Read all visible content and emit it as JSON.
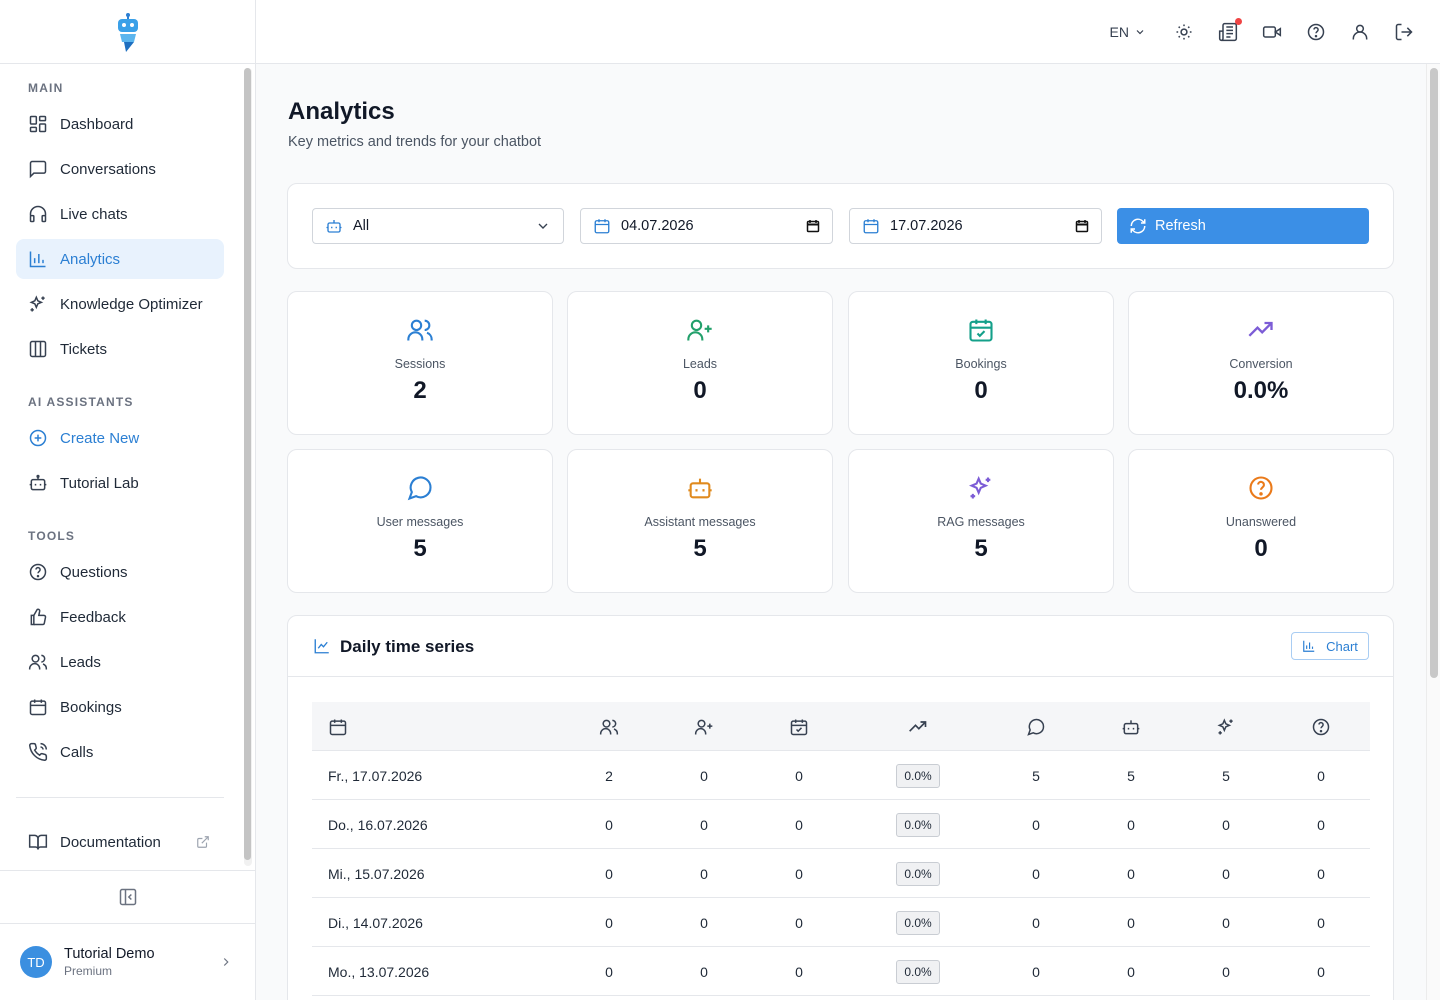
{
  "sidebar": {
    "sections": {
      "main": "MAIN",
      "ai": "AI ASSISTANTS",
      "tools": "TOOLS"
    },
    "main_items": [
      {
        "label": "Dashboard",
        "icon": "dashboard-icon"
      },
      {
        "label": "Conversations",
        "icon": "chat-icon"
      },
      {
        "label": "Live chats",
        "icon": "headset-icon"
      },
      {
        "label": "Analytics",
        "icon": "bar-chart-icon"
      },
      {
        "label": "Knowledge Optimizer",
        "icon": "sparkles-icon"
      },
      {
        "label": "Tickets",
        "icon": "columns-icon"
      }
    ],
    "ai_items": [
      {
        "label": "Create New",
        "icon": "plus-circle-icon"
      },
      {
        "label": "Tutorial Lab",
        "icon": "bot-icon"
      }
    ],
    "tools_items": [
      {
        "label": "Questions",
        "icon": "help-circle-icon"
      },
      {
        "label": "Feedback",
        "icon": "thumbs-up-icon"
      },
      {
        "label": "Leads",
        "icon": "users-icon"
      },
      {
        "label": "Bookings",
        "icon": "calendar-icon"
      },
      {
        "label": "Calls",
        "icon": "phone-icon"
      }
    ],
    "documentation": "Documentation",
    "user": {
      "initials": "TD",
      "name": "Tutorial Demo",
      "plan": "Premium"
    }
  },
  "topbar": {
    "language": "EN"
  },
  "page": {
    "title": "Analytics",
    "subtitle": "Key metrics and trends for your chatbot"
  },
  "filters": {
    "bot_select": "All",
    "date_from": "04.07.2026",
    "date_to": "17.07.2026",
    "refresh": "Refresh"
  },
  "stats": [
    {
      "label": "Sessions",
      "value": "2",
      "color": "#2b7fd3"
    },
    {
      "label": "Leads",
      "value": "0",
      "color": "#22a06b"
    },
    {
      "label": "Bookings",
      "value": "0",
      "color": "#14a08a"
    },
    {
      "label": "Conversion",
      "value": "0.0%",
      "color": "#7c5cd6"
    },
    {
      "label": "User messages",
      "value": "5",
      "color": "#2b7fd3"
    },
    {
      "label": "Assistant messages",
      "value": "5",
      "color": "#e08a1e"
    },
    {
      "label": "RAG messages",
      "value": "5",
      "color": "#7c5cd6"
    },
    {
      "label": "Unanswered",
      "value": "0",
      "color": "#ea7a1a"
    }
  ],
  "timeseries": {
    "title": "Daily time series",
    "chart_button": "Chart",
    "rows": [
      {
        "date": "Fr., 17.07.2026",
        "sessions": "2",
        "leads": "0",
        "bookings": "0",
        "conversion": "0.0%",
        "user": "5",
        "assistant": "5",
        "rag": "5",
        "unanswered": "0"
      },
      {
        "date": "Do., 16.07.2026",
        "sessions": "0",
        "leads": "0",
        "bookings": "0",
        "conversion": "0.0%",
        "user": "0",
        "assistant": "0",
        "rag": "0",
        "unanswered": "0"
      },
      {
        "date": "Mi., 15.07.2026",
        "sessions": "0",
        "leads": "0",
        "bookings": "0",
        "conversion": "0.0%",
        "user": "0",
        "assistant": "0",
        "rag": "0",
        "unanswered": "0"
      },
      {
        "date": "Di., 14.07.2026",
        "sessions": "0",
        "leads": "0",
        "bookings": "0",
        "conversion": "0.0%",
        "user": "0",
        "assistant": "0",
        "rag": "0",
        "unanswered": "0"
      },
      {
        "date": "Mo., 13.07.2026",
        "sessions": "0",
        "leads": "0",
        "bookings": "0",
        "conversion": "0.0%",
        "user": "0",
        "assistant": "0",
        "rag": "0",
        "unanswered": "0"
      }
    ]
  }
}
